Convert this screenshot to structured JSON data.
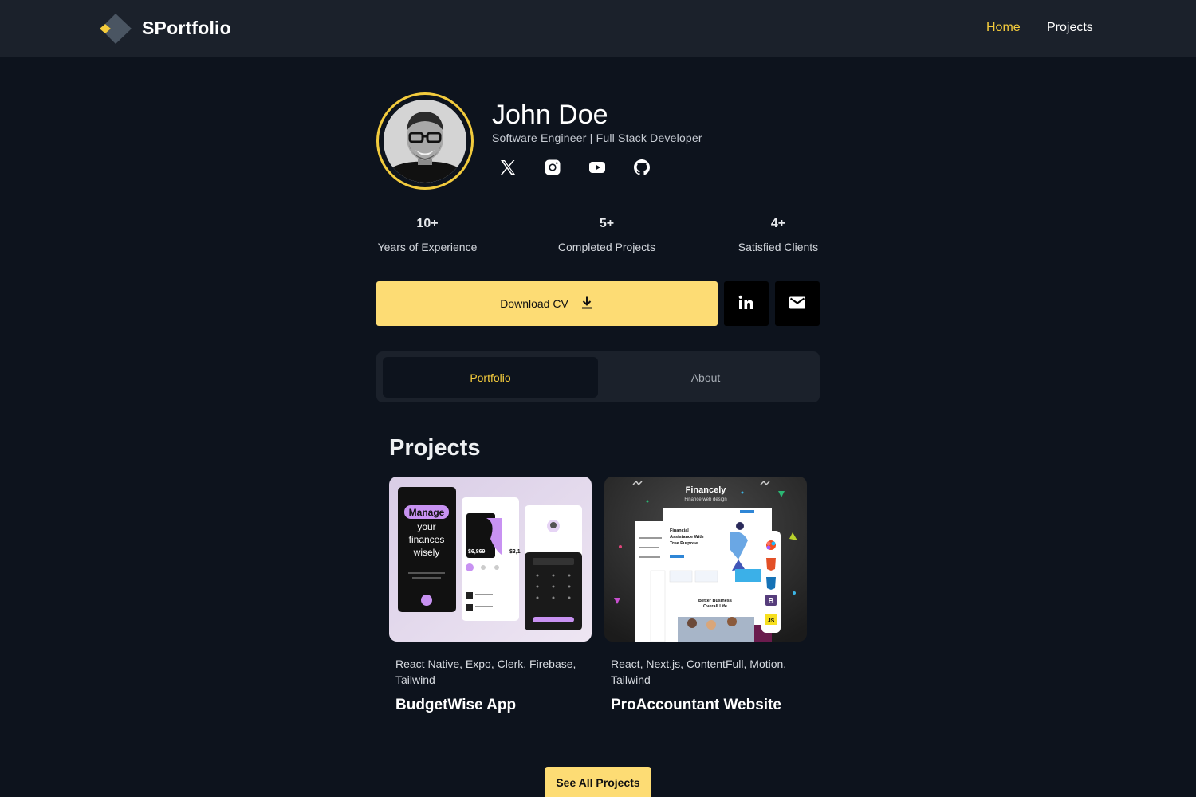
{
  "nav": {
    "brand": "SPortfolio",
    "links": [
      {
        "label": "Home",
        "active": true
      },
      {
        "label": "Projects",
        "active": false
      }
    ]
  },
  "profile": {
    "name": "John Doe",
    "role": "Software Engineer | Full Stack Developer",
    "socials": [
      "x-icon",
      "instagram-icon",
      "youtube-icon",
      "github-icon"
    ]
  },
  "stats": [
    {
      "value": "10+",
      "label": "Years of Experience"
    },
    {
      "value": "5+",
      "label": "Completed Projects"
    },
    {
      "value": "4+",
      "label": "Satisfied Clients"
    }
  ],
  "actions": {
    "download_cv": "Download CV",
    "linkedin": "linkedin-icon",
    "email": "mail-icon"
  },
  "tabs": [
    {
      "label": "Portfolio",
      "active": true
    },
    {
      "label": "About",
      "active": false
    }
  ],
  "projects": {
    "title": "Projects",
    "items": [
      {
        "tags": "React Native, Expo, Clerk, Firebase, Tailwind",
        "title": "BudgetWise App",
        "thumb": {
          "headline": [
            "Manage",
            "your",
            "finances",
            "wisely"
          ],
          "amount": "$6,869",
          "amount2": "$3,1"
        }
      },
      {
        "tags": "React, Next.js, ContentFull, Motion, Tailwind",
        "title": "ProAccountant Website",
        "thumb": {
          "brand": "Financely",
          "tagline": "Finance web design",
          "hero": [
            "Financial",
            "Assistance With",
            "True Purpose"
          ],
          "section": [
            "Better Business",
            "Overall Life"
          ]
        }
      }
    ],
    "see_all": "See All Projects"
  },
  "colors": {
    "accent": "#f5cc3c",
    "button": "#fddc74",
    "background": "#0d131d",
    "navbar": "#1b212b"
  }
}
